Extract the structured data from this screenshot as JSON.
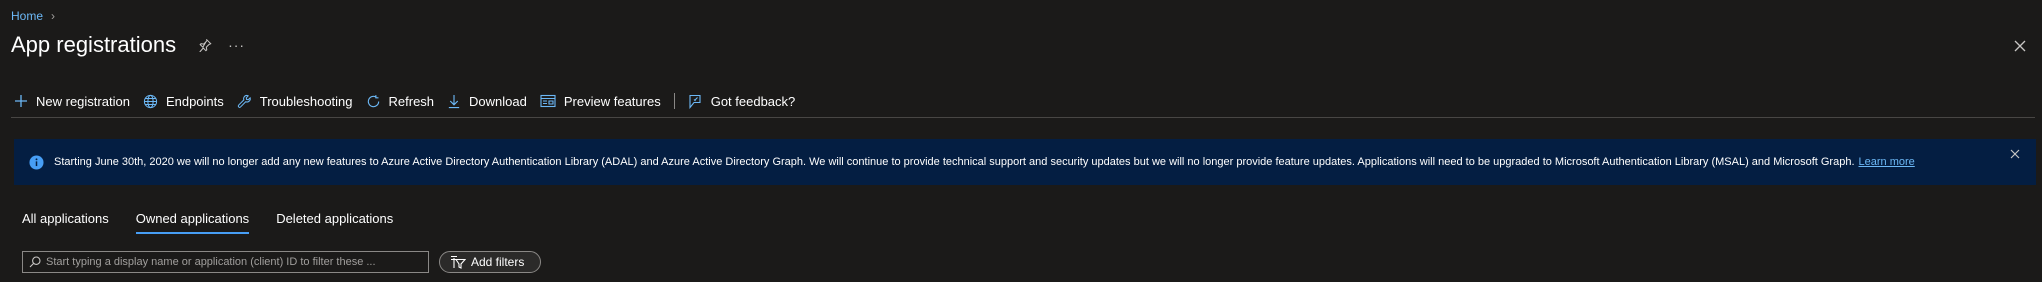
{
  "breadcrumb": {
    "home": "Home",
    "separator": "›"
  },
  "header": {
    "title": "App registrations",
    "more": "···"
  },
  "toolbar": {
    "new_registration": "New registration",
    "endpoints": "Endpoints",
    "troubleshooting": "Troubleshooting",
    "refresh": "Refresh",
    "download": "Download",
    "preview_features": "Preview features",
    "got_feedback": "Got feedback?"
  },
  "banner": {
    "message": "Starting June 30th, 2020 we will no longer add any new features to Azure Active Directory Authentication Library (ADAL) and Azure Active Directory Graph. We will continue to provide technical support and security updates but we will no longer provide feature updates. Applications will need to be upgraded to Microsoft Authentication Library (MSAL) and Microsoft Graph.",
    "link": "Learn more"
  },
  "tabs": [
    {
      "label": "All applications",
      "active": false
    },
    {
      "label": "Owned applications",
      "active": true
    },
    {
      "label": "Deleted applications",
      "active": false
    }
  ],
  "search": {
    "placeholder": "Start typing a display name or application (client) ID to filter these ..."
  },
  "filters": {
    "add_label": "Add filters"
  },
  "colors": {
    "background": "#1b1a19",
    "accent": "#479ef5",
    "link": "#6cb8f6",
    "banner_bg": "#041e42"
  }
}
